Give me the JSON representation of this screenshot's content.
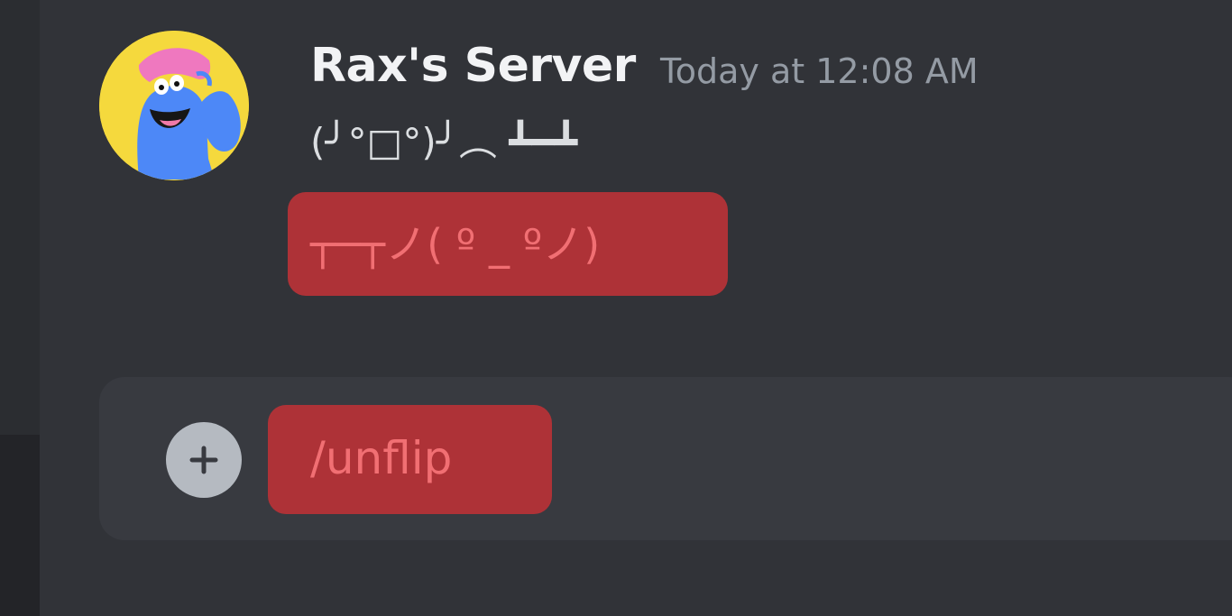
{
  "message": {
    "author": "Rax's Server",
    "timestamp": "Today at 12:08 AM",
    "text": "(╯°□°)╯︵ ┻━┻",
    "highlighted_response": "┬─┬ノ( º _ ºノ)"
  },
  "composer": {
    "command": "/unflip",
    "attach_icon": "plus-icon"
  },
  "colors": {
    "background": "#313338",
    "left_rail": "#2b2d31",
    "composer_background": "#383a40",
    "highlight": "#ae3237",
    "highlight_text": "#f16f73",
    "author_text": "#f2f3f5",
    "timestamp_text": "#949ba4"
  }
}
